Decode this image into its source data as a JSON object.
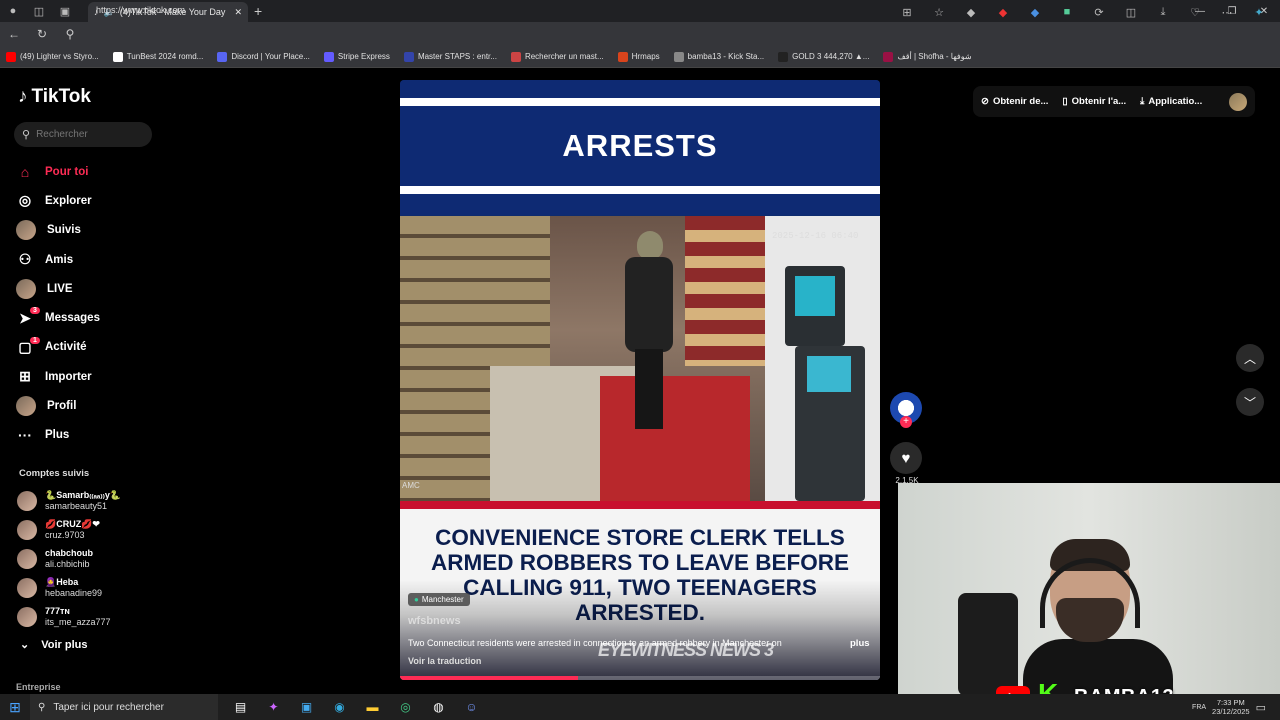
{
  "browser": {
    "tab_title": "(4)TikTok - Make Your Day",
    "url": "https://www.tiktok.com",
    "bookmarks": [
      {
        "label": "(49) Lighter vs Styro...",
        "color": "#ff0000"
      },
      {
        "label": "TunBest 2024 romd...",
        "color": "#ffffff"
      },
      {
        "label": "Discord | Your Place...",
        "color": "#5865f2"
      },
      {
        "label": "Stripe Express",
        "color": "#635bff"
      },
      {
        "label": "Master STAPS : entr...",
        "color": "#3344aa"
      },
      {
        "label": "Rechercher un mast...",
        "color": "#cc4444"
      },
      {
        "label": "Hrmaps",
        "color": "#d9441c"
      },
      {
        "label": "bamba13 - Kick Sta...",
        "color": "#888888"
      },
      {
        "label": "GOLD 3 444,270 ▲...",
        "color": "#222222"
      },
      {
        "label": "أقف | Shofha - شوفها",
        "color": "#991144"
      }
    ]
  },
  "tiktok": {
    "logo": "TikTok",
    "search_placeholder": "Rechercher",
    "menu": [
      {
        "label": "Pour toi",
        "icon": "home-icon",
        "active": true
      },
      {
        "label": "Explorer",
        "icon": "compass-icon"
      },
      {
        "label": "Suivis",
        "icon": "following-avatar"
      },
      {
        "label": "Amis",
        "icon": "friends-icon"
      },
      {
        "label": "LIVE",
        "icon": "live-avatar"
      },
      {
        "label": "Messages",
        "icon": "send-icon",
        "badge": "3"
      },
      {
        "label": "Activité",
        "icon": "inbox-icon",
        "badge": "1"
      },
      {
        "label": "Importer",
        "icon": "upload-icon"
      },
      {
        "label": "Profil",
        "icon": "profile-avatar"
      },
      {
        "label": "Plus",
        "icon": "more-icon"
      }
    ],
    "followed_title": "Comptes suivis",
    "followed": [
      {
        "name": "🐍Samarb₍₍ₐₐ₎₎y🐍",
        "user": "samarbeauty51"
      },
      {
        "name": "💋CRUZ💋❤",
        "user": "cruz.9703"
      },
      {
        "name": "chabchoub",
        "user": "ali.chbichib"
      },
      {
        "name": "🧕Heba",
        "user": "hebanadine99"
      },
      {
        "name": "777ᴛɴ",
        "user": "its_me_azza777"
      }
    ],
    "see_more": "Voir plus",
    "footer": "Entreprise",
    "top_actions": [
      "Obtenir de...",
      "Obtenir l'a...",
      "Applicatio..."
    ]
  },
  "video": {
    "banner": "ARRESTS",
    "cam_timestamp": "2025-12-16 06:40",
    "cam_label": "AMC",
    "headline": "CONVENIENCE STORE CLERK TELLS ARMED ROBBERS TO LEAVE BEFORE CALLING 911, TWO TEENAGERS ARRESTED.",
    "location": "Manchester",
    "author": "wfsbnews",
    "description": "Two Connecticut residents were arrested in connection to an armed robbery in Manchester on",
    "more": "plus",
    "translate": "Voir la traduction",
    "watermark": "EYEWITNESS NEWS 3",
    "like_count": "2.1.5K",
    "progress": 0.37
  },
  "overlay": {
    "streamer": "BAMBA13",
    "kick_letter": "K"
  },
  "taskbar": {
    "search_placeholder": "Taper ici pour rechercher",
    "lang": "FRA",
    "time": "7:33 PM",
    "date": "23/12/2025"
  }
}
